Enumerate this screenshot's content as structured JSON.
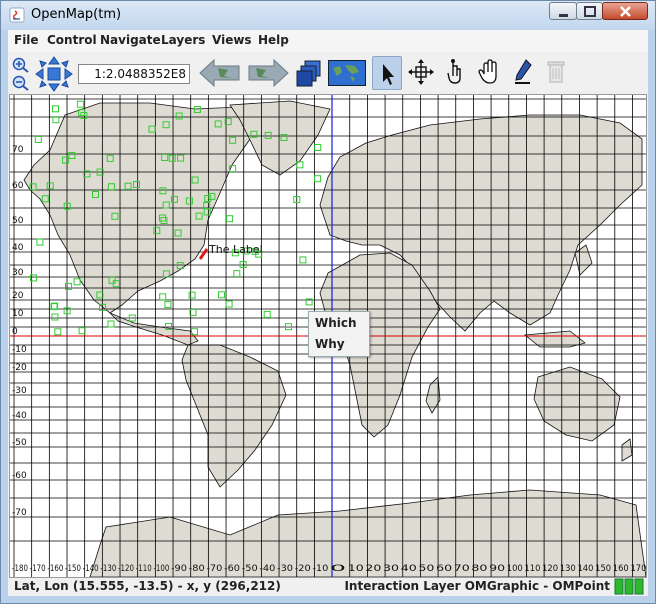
{
  "window": {
    "title": "OpenMap(tm)"
  },
  "menubar": {
    "items": [
      "File",
      "Control",
      "Navigate",
      "Layers",
      "Views",
      "Help"
    ]
  },
  "toolbar": {
    "scale_value": "1:2.0488352E8",
    "icons": [
      "zoom-in-icon",
      "zoom-out-icon",
      "pan-arrows-icon",
      "back-projection-icon",
      "forward-projection-icon",
      "layers-icon",
      "overview-map-icon",
      "select-arrow-icon",
      "crosshair-icon",
      "distance-icon",
      "pan-hand-icon",
      "draw-pencil-icon",
      "delete-icon"
    ]
  },
  "map": {
    "lat_labels": [
      "70",
      "60",
      "50",
      "40",
      "30",
      "20",
      "10",
      "0",
      "-10",
      "-20",
      "-30",
      "-40",
      "-50",
      "-60",
      "-70"
    ],
    "lon_labels": [
      "-180",
      "-170",
      "-160",
      "-150",
      "-140",
      "-130",
      "-120",
      "-110",
      "-100",
      "-90",
      "-80",
      "-70",
      "-60",
      "-50",
      "-40",
      "-30",
      "-20",
      "-10",
      "0",
      "10",
      "20",
      "30",
      "40",
      "50",
      "60",
      "70",
      "80",
      "90",
      "100",
      "110",
      "120",
      "130",
      "140",
      "150",
      "160",
      "170"
    ],
    "annotation": "The Label",
    "colors": {
      "land": "#dedbd2",
      "grid": "#000000",
      "equator": "#d40000",
      "meridian": "#1a1adb",
      "points": "#33cc33"
    }
  },
  "popup": {
    "items": [
      "Which",
      "Why"
    ]
  },
  "status": {
    "coords": "Lat, Lon (15.555, -13.5) - x, y (296,212)",
    "layer": "Interaction Layer OMGraphic - OMPoint"
  }
}
